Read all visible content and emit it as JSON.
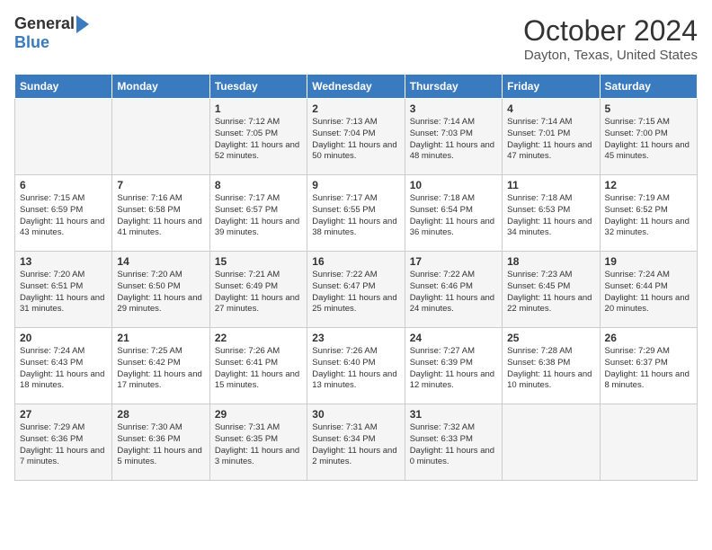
{
  "header": {
    "logo_general": "General",
    "logo_blue": "Blue",
    "month": "October 2024",
    "location": "Dayton, Texas, United States"
  },
  "days_of_week": [
    "Sunday",
    "Monday",
    "Tuesday",
    "Wednesday",
    "Thursday",
    "Friday",
    "Saturday"
  ],
  "weeks": [
    [
      {
        "day": "",
        "content": ""
      },
      {
        "day": "",
        "content": ""
      },
      {
        "day": "1",
        "content": "Sunrise: 7:12 AM\nSunset: 7:05 PM\nDaylight: 11 hours and 52 minutes."
      },
      {
        "day": "2",
        "content": "Sunrise: 7:13 AM\nSunset: 7:04 PM\nDaylight: 11 hours and 50 minutes."
      },
      {
        "day": "3",
        "content": "Sunrise: 7:14 AM\nSunset: 7:03 PM\nDaylight: 11 hours and 48 minutes."
      },
      {
        "day": "4",
        "content": "Sunrise: 7:14 AM\nSunset: 7:01 PM\nDaylight: 11 hours and 47 minutes."
      },
      {
        "day": "5",
        "content": "Sunrise: 7:15 AM\nSunset: 7:00 PM\nDaylight: 11 hours and 45 minutes."
      }
    ],
    [
      {
        "day": "6",
        "content": "Sunrise: 7:15 AM\nSunset: 6:59 PM\nDaylight: 11 hours and 43 minutes."
      },
      {
        "day": "7",
        "content": "Sunrise: 7:16 AM\nSunset: 6:58 PM\nDaylight: 11 hours and 41 minutes."
      },
      {
        "day": "8",
        "content": "Sunrise: 7:17 AM\nSunset: 6:57 PM\nDaylight: 11 hours and 39 minutes."
      },
      {
        "day": "9",
        "content": "Sunrise: 7:17 AM\nSunset: 6:55 PM\nDaylight: 11 hours and 38 minutes."
      },
      {
        "day": "10",
        "content": "Sunrise: 7:18 AM\nSunset: 6:54 PM\nDaylight: 11 hours and 36 minutes."
      },
      {
        "day": "11",
        "content": "Sunrise: 7:18 AM\nSunset: 6:53 PM\nDaylight: 11 hours and 34 minutes."
      },
      {
        "day": "12",
        "content": "Sunrise: 7:19 AM\nSunset: 6:52 PM\nDaylight: 11 hours and 32 minutes."
      }
    ],
    [
      {
        "day": "13",
        "content": "Sunrise: 7:20 AM\nSunset: 6:51 PM\nDaylight: 11 hours and 31 minutes."
      },
      {
        "day": "14",
        "content": "Sunrise: 7:20 AM\nSunset: 6:50 PM\nDaylight: 11 hours and 29 minutes."
      },
      {
        "day": "15",
        "content": "Sunrise: 7:21 AM\nSunset: 6:49 PM\nDaylight: 11 hours and 27 minutes."
      },
      {
        "day": "16",
        "content": "Sunrise: 7:22 AM\nSunset: 6:47 PM\nDaylight: 11 hours and 25 minutes."
      },
      {
        "day": "17",
        "content": "Sunrise: 7:22 AM\nSunset: 6:46 PM\nDaylight: 11 hours and 24 minutes."
      },
      {
        "day": "18",
        "content": "Sunrise: 7:23 AM\nSunset: 6:45 PM\nDaylight: 11 hours and 22 minutes."
      },
      {
        "day": "19",
        "content": "Sunrise: 7:24 AM\nSunset: 6:44 PM\nDaylight: 11 hours and 20 minutes."
      }
    ],
    [
      {
        "day": "20",
        "content": "Sunrise: 7:24 AM\nSunset: 6:43 PM\nDaylight: 11 hours and 18 minutes."
      },
      {
        "day": "21",
        "content": "Sunrise: 7:25 AM\nSunset: 6:42 PM\nDaylight: 11 hours and 17 minutes."
      },
      {
        "day": "22",
        "content": "Sunrise: 7:26 AM\nSunset: 6:41 PM\nDaylight: 11 hours and 15 minutes."
      },
      {
        "day": "23",
        "content": "Sunrise: 7:26 AM\nSunset: 6:40 PM\nDaylight: 11 hours and 13 minutes."
      },
      {
        "day": "24",
        "content": "Sunrise: 7:27 AM\nSunset: 6:39 PM\nDaylight: 11 hours and 12 minutes."
      },
      {
        "day": "25",
        "content": "Sunrise: 7:28 AM\nSunset: 6:38 PM\nDaylight: 11 hours and 10 minutes."
      },
      {
        "day": "26",
        "content": "Sunrise: 7:29 AM\nSunset: 6:37 PM\nDaylight: 11 hours and 8 minutes."
      }
    ],
    [
      {
        "day": "27",
        "content": "Sunrise: 7:29 AM\nSunset: 6:36 PM\nDaylight: 11 hours and 7 minutes."
      },
      {
        "day": "28",
        "content": "Sunrise: 7:30 AM\nSunset: 6:36 PM\nDaylight: 11 hours and 5 minutes."
      },
      {
        "day": "29",
        "content": "Sunrise: 7:31 AM\nSunset: 6:35 PM\nDaylight: 11 hours and 3 minutes."
      },
      {
        "day": "30",
        "content": "Sunrise: 7:31 AM\nSunset: 6:34 PM\nDaylight: 11 hours and 2 minutes."
      },
      {
        "day": "31",
        "content": "Sunrise: 7:32 AM\nSunset: 6:33 PM\nDaylight: 11 hours and 0 minutes."
      },
      {
        "day": "",
        "content": ""
      },
      {
        "day": "",
        "content": ""
      }
    ]
  ]
}
